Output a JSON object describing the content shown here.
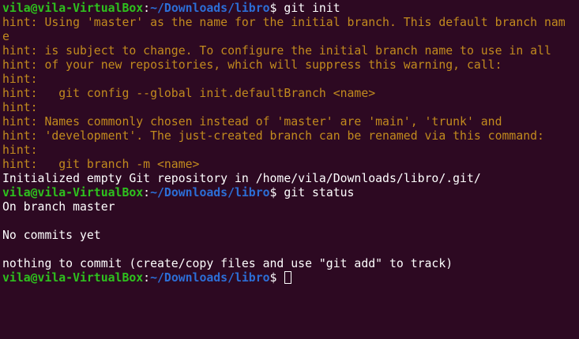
{
  "colors": {
    "background": "#2d0922",
    "user": "#2ec11e",
    "path": "#2c6ed6",
    "hint": "#c28b1e",
    "text": "#ffffff"
  },
  "prompt": {
    "user_host": "vila@vila-VirtualBox",
    "colon": ":",
    "path": "~/Downloads/libro",
    "dollar": "$ "
  },
  "commands": {
    "first": "git init",
    "second": "git status",
    "third": ""
  },
  "hints": [
    "hint: Using 'master' as the name for the initial branch. This default branch nam",
    "e",
    "hint: is subject to change. To configure the initial branch name to use in all",
    "hint: of your new repositories, which will suppress this warning, call:",
    "hint:",
    "hint:   git config --global init.defaultBranch <name>",
    "hint:",
    "hint: Names commonly chosen instead of 'master' are 'main', 'trunk' and",
    "hint: 'development'. The just-created branch can be renamed via this command:",
    "hint:",
    "hint:   git branch -m <name>"
  ],
  "output": {
    "initialized": "Initialized empty Git repository in /home/vila/Downloads/libro/.git/",
    "on_branch": "On branch master",
    "no_commits": "No commits yet",
    "nothing_to_commit": "nothing to commit (create/copy files and use \"git add\" to track)"
  }
}
